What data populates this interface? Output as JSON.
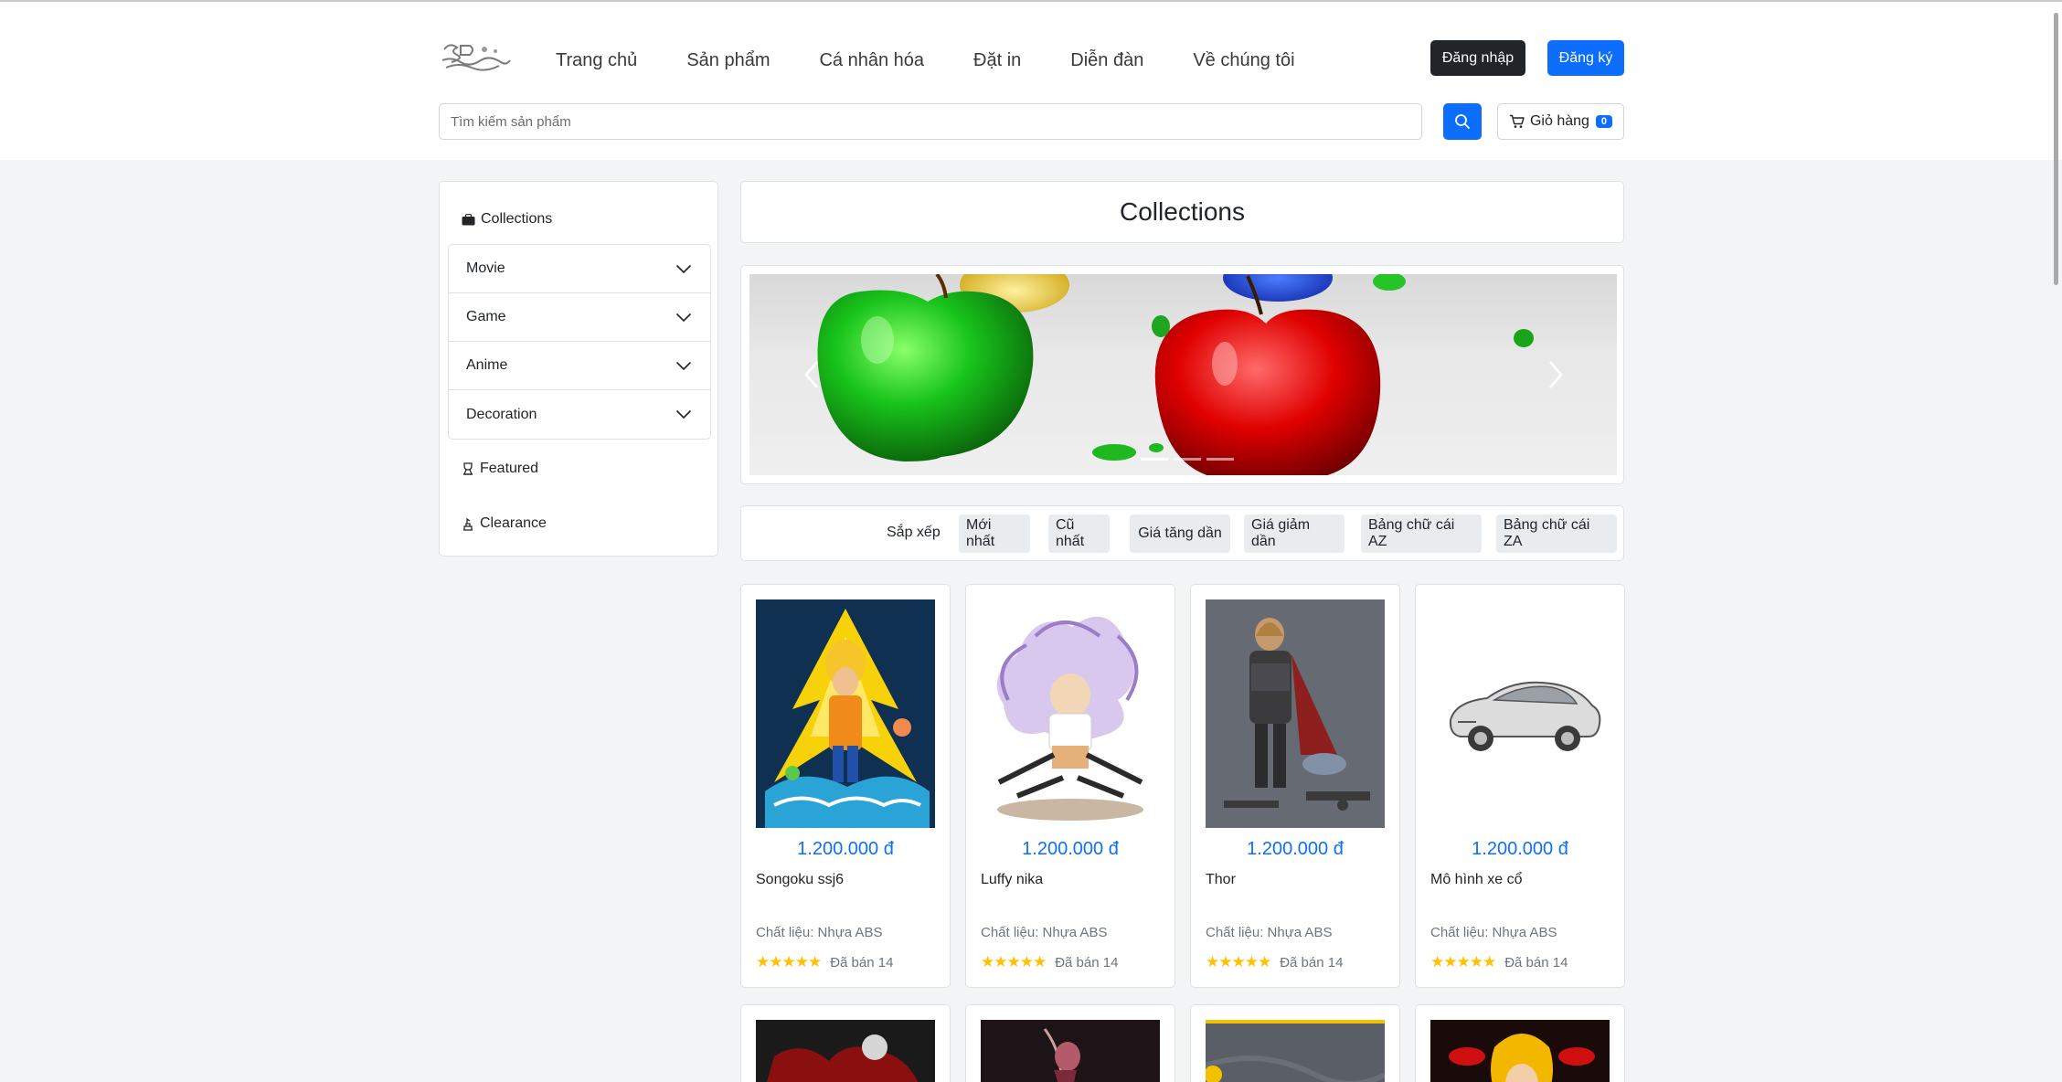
{
  "header": {
    "nav": [
      "Trang chủ",
      "Sản phẩm",
      "Cá nhân hóa",
      "Đặt in",
      "Diễn đàn",
      "Về chúng tôi"
    ],
    "login_label": "Đăng nhập",
    "register_label": "Đăng ký",
    "search_placeholder": "Tìm kiếm sản phẩm",
    "cart_label": "Giỏ hàng",
    "cart_count": "0"
  },
  "sidebar": {
    "heading": "Collections",
    "categories": [
      "Movie",
      "Game",
      "Anime",
      "Decoration"
    ],
    "featured_label": "Featured",
    "clearance_label": "Clearance"
  },
  "main": {
    "title": "Collections",
    "carousel": {
      "slides": 3,
      "active_slide": 1
    },
    "sort": {
      "label": "Sắp xếp",
      "options": [
        "Mới nhất",
        "Cũ nhất",
        "Giá tăng dần",
        "Giá giảm dần",
        "Bảng chữ cái AZ",
        "Bảng chữ cái ZA"
      ]
    },
    "products": [
      {
        "name": "Songoku ssj6",
        "price": "1.200.000 đ",
        "material": "Chất liệu: Nhựa ABS",
        "sold": "Đã bán 14",
        "rating": 5
      },
      {
        "name": "Luffy nika",
        "price": "1.200.000 đ",
        "material": "Chất liệu: Nhựa ABS",
        "sold": "Đã bán 14",
        "rating": 5
      },
      {
        "name": "Thor",
        "price": "1.200.000 đ",
        "material": "Chất liệu: Nhựa ABS",
        "sold": "Đã bán 14",
        "rating": 5
      },
      {
        "name": "Mô hình xe cổ",
        "price": "1.200.000 đ",
        "material": "Chất liệu: Nhựa ABS",
        "sold": "Đã bán 14",
        "rating": 5
      }
    ],
    "stars": "★★★★★"
  },
  "colors": {
    "primary": "#0d6efd",
    "dark": "#212529",
    "star": "#ffc107",
    "background": "#f3f4f6"
  }
}
